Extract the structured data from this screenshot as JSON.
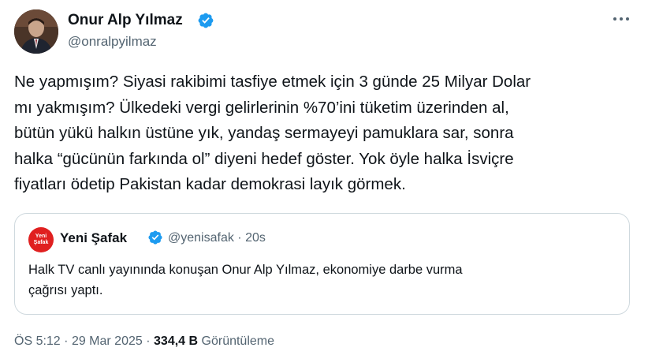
{
  "author": {
    "display_name": "Onur Alp Yılmaz",
    "handle": "@onralpyilmaz",
    "avatar_icon": "person-avatar-icon",
    "verified_icon": "verified-badge-icon"
  },
  "tweet": {
    "lines": [
      "Ne yapmışım? Siyasi rakibimi tasfiye etmek için 3 günde 25 Milyar Dolar",
      "mı yakmışım? Ülkedeki vergi gelirlerinin %70’ini tüketim üzerinden al,",
      "bütün yükü halkın üstüne yık, yandaş sermayeyi pamuklara sar, sonra",
      "halka “gücünün farkında ol” diyeni hedef göster. Yok öyle halka İsviçre",
      "fiyatları ödetip Pakistan kadar demokrasi layık görmek."
    ]
  },
  "quote": {
    "logo_text": [
      "Yeni",
      "Şafak"
    ],
    "display_name": "Yeni Şafak",
    "handle": "@yenisafak",
    "separator": "·",
    "time": "20s",
    "lines": [
      "Halk TV canlı yayınında konuşan Onur Alp Yılmaz, ekonomiye darbe vurma",
      "çağrısı yaptı."
    ]
  },
  "footer": {
    "time": "ÖS 5:12",
    "date": "29 Mar 2025",
    "separator": "·",
    "views_count": "334,4 B",
    "views_label": "Görüntüleme"
  },
  "colors": {
    "text_primary": "#0f1419",
    "text_secondary": "#536471",
    "verified_blue": "#1d9bf0",
    "border": "#cfd9de",
    "yeni_safak_red": "#e02020"
  }
}
